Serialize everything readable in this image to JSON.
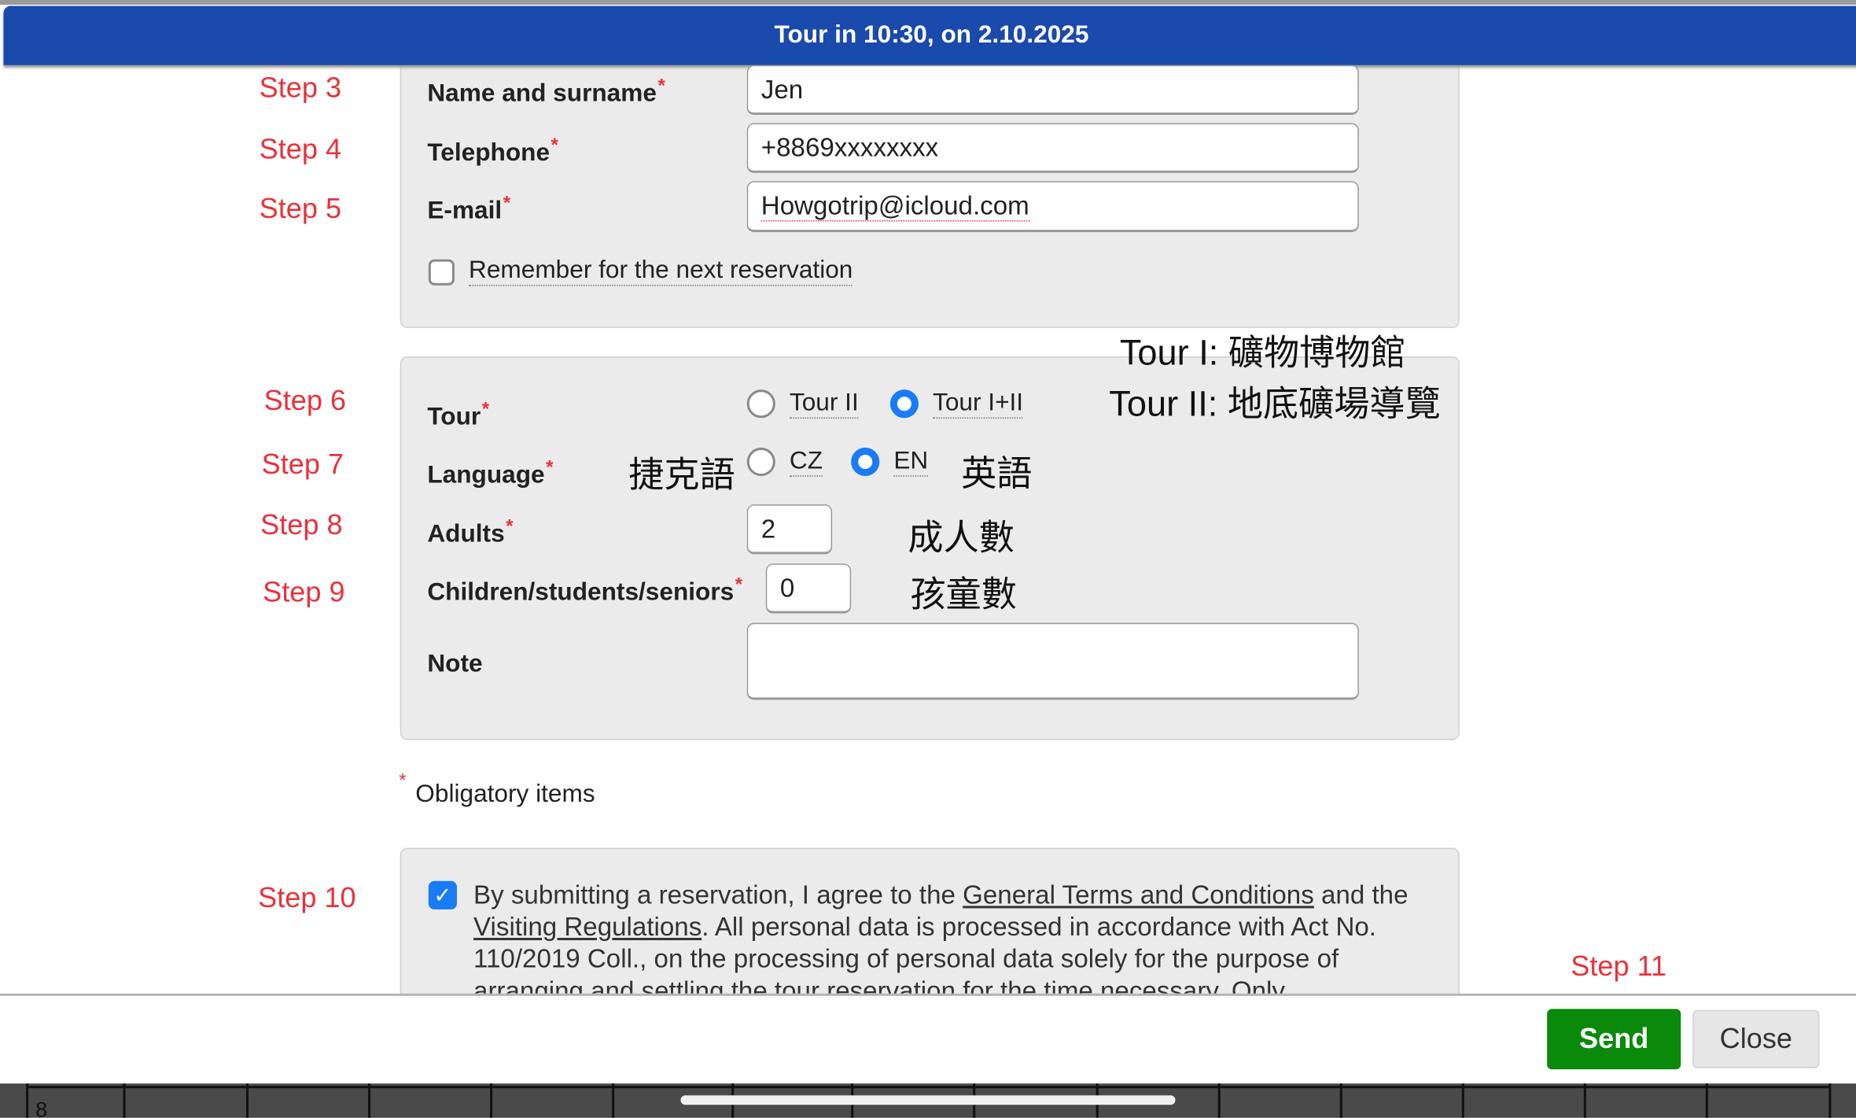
{
  "header": {
    "title": "Tour in 10:30, on 2.10.2025"
  },
  "steps": {
    "s3": "Step 3",
    "s4": "Step 4",
    "s5": "Step 5",
    "s6": "Step 6",
    "s7": "Step 7",
    "s8": "Step 8",
    "s9": "Step 9",
    "s10": "Step 10",
    "s11": "Step 11"
  },
  "contact": {
    "name_label": "Name and surname",
    "name_value": "Jen",
    "phone_label": "Telephone",
    "phone_value": "+8869xxxxxxxx",
    "email_label": "E-mail",
    "email_value": "Howgotrip@icloud.com",
    "remember_label": "Remember for the next reservation",
    "remember_checked": false
  },
  "booking": {
    "tour_label": "Tour",
    "tour_options": [
      "Tour II",
      "Tour I+II"
    ],
    "tour_selected": "Tour I+II",
    "language_label": "Language",
    "language_options": [
      "CZ",
      "EN"
    ],
    "language_selected": "EN",
    "adults_label": "Adults",
    "adults_value": "2",
    "children_label": "Children/students/seniors",
    "children_value": "0",
    "note_label": "Note",
    "note_value": ""
  },
  "annotations": {
    "tour1": "Tour I: 礦物博物館",
    "tour2": "Tour II: 地底礦場導覽",
    "cz": "捷克語",
    "en": "英語",
    "adults": "成人數",
    "children": "孩童數"
  },
  "required_mark": "*",
  "obligatory": "Obligatory items",
  "agreement": {
    "checked": true,
    "t1": "By submitting a reservation, I agree to the ",
    "link1": "General Terms and Conditions",
    "t2": " and the ",
    "link2": "Visiting Regulations",
    "t3": ". All personal data is processed in accordance with Act No. 110/2019 Coll., on the processing of personal data solely for the purpose of arranging and settling the tour reservation for the time necessary. Only"
  },
  "footer": {
    "send": "Send",
    "close": "Close"
  },
  "background": {
    "cell": "8"
  },
  "colors": {
    "header": "#1a4aab",
    "step": "#e8323c",
    "send": "#0a8a0a",
    "radio": "#1a7cf5"
  }
}
